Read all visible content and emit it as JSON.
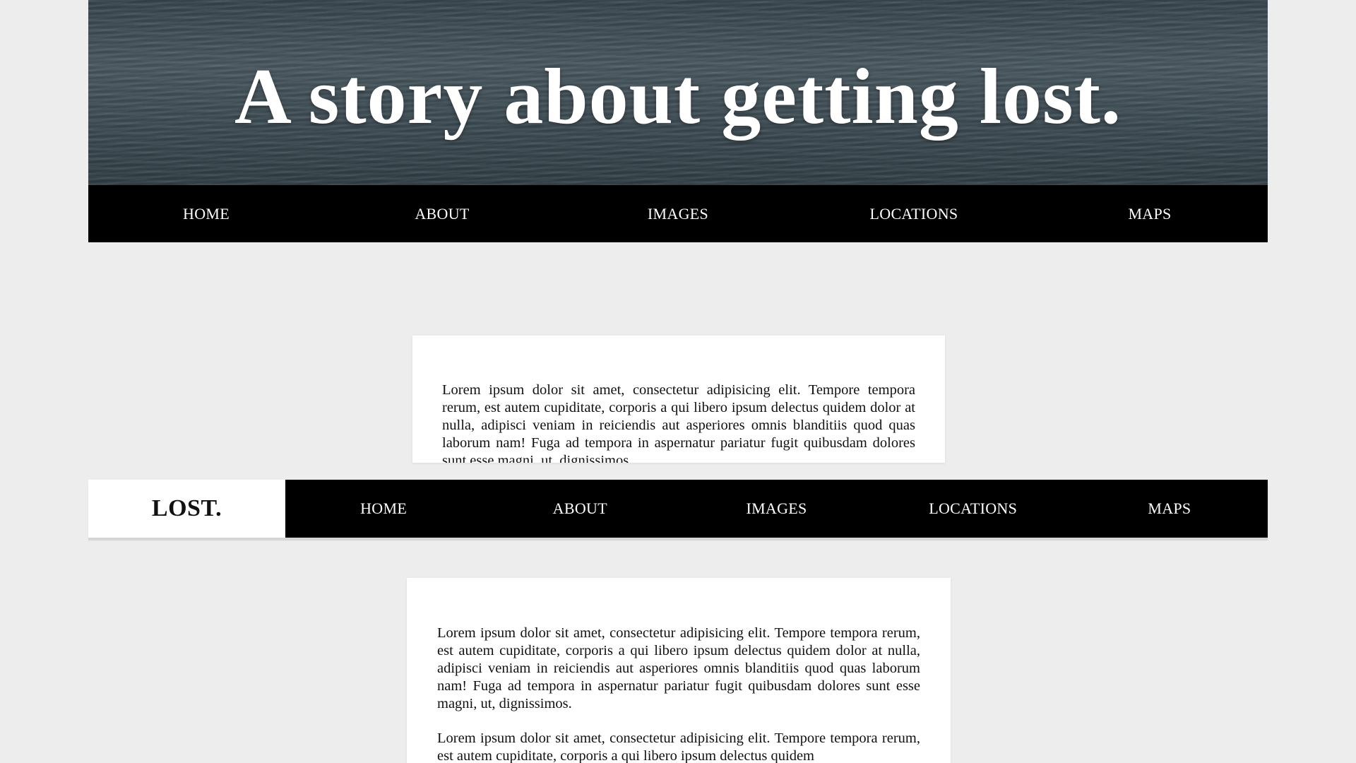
{
  "hero": {
    "title": "A story about getting lost."
  },
  "top_nav": {
    "items": [
      "HOME",
      "ABOUT",
      "IMAGES",
      "LOCATIONS",
      "MAPS"
    ]
  },
  "sticky_nav": {
    "brand": "LOST.",
    "items": [
      "HOME",
      "ABOUT",
      "IMAGES",
      "LOCATIONS",
      "MAPS"
    ]
  },
  "content": {
    "card1_paragraph": "Lorem ipsum dolor sit amet, consectetur adipisicing elit. Tempore tempora rerum, est autem cupiditate, corporis a qui libero ipsum delectus quidem dolor at nulla, adipisci veniam in reiciendis aut asperiores omnis blanditiis quod quas laborum nam! Fuga ad tempora in aspernatur pariatur fugit quibusdam dolores sunt esse magni, ut, dignissimos.",
    "card2_paragraph1": "Lorem ipsum dolor sit amet, consectetur adipisicing elit. Tempore tempora rerum, est autem cupiditate, corporis a qui libero ipsum delectus quidem dolor at nulla, adipisci veniam in reiciendis aut asperiores omnis blanditiis quod quas laborum nam! Fuga ad tempora in aspernatur pariatur fugit quibusdam dolores sunt esse magni, ut, dignissimos.",
    "card2_paragraph2": "Lorem ipsum dolor sit amet, consectetur adipisicing elit. Tempore tempora rerum, est autem cupiditate, corporis a qui libero ipsum delectus quidem"
  },
  "colors": {
    "page_background": "#ededed",
    "nav_background": "#000000",
    "nav_text": "#ffffff",
    "card_background": "#ffffff",
    "hero_water": "#3f4e56"
  }
}
